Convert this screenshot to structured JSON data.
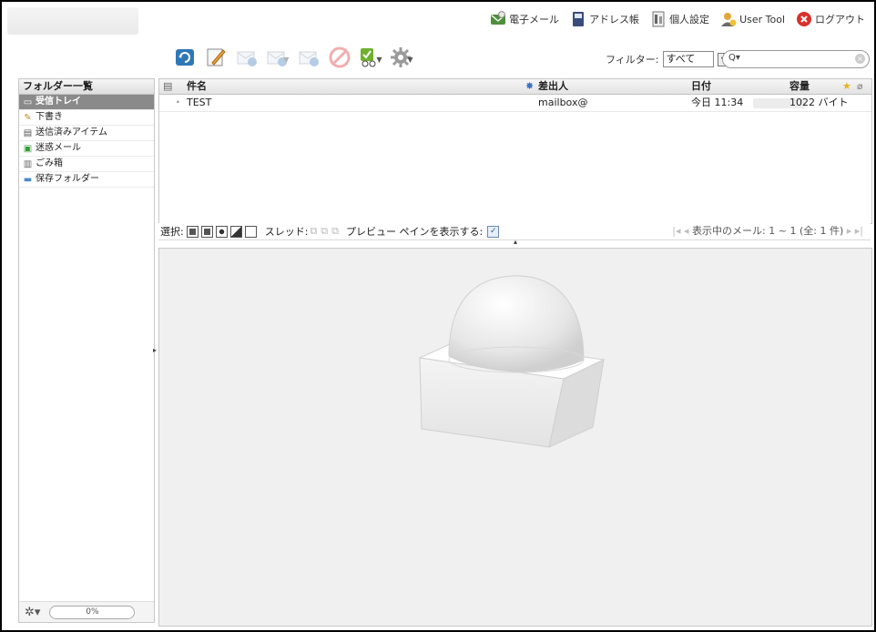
{
  "topnav": {
    "items": [
      {
        "label": "電子メール",
        "icon": "mail-icon"
      },
      {
        "label": "アドレス帳",
        "icon": "address-book-icon"
      },
      {
        "label": "個人設定",
        "icon": "settings-icon"
      },
      {
        "label": "User Tool",
        "icon": "user-icon"
      },
      {
        "label": "ログアウト",
        "icon": "logout-icon"
      }
    ]
  },
  "toolbar": {
    "buttons": [
      {
        "name": "check-mail",
        "icon": "refresh-icon"
      },
      {
        "name": "compose",
        "icon": "pencil-icon"
      },
      {
        "name": "reply",
        "icon": "reply-icon"
      },
      {
        "name": "reply-all",
        "icon": "reply-all-icon"
      },
      {
        "name": "forward",
        "icon": "forward-icon"
      },
      {
        "name": "delete",
        "icon": "delete-icon"
      },
      {
        "name": "mark",
        "icon": "mark-icon"
      },
      {
        "name": "more",
        "icon": "gear-icon"
      }
    ]
  },
  "filter": {
    "label": "フィルター:",
    "value": "すべて"
  },
  "search": {
    "placeholder": ""
  },
  "folders": {
    "header": "フォルダー一覧",
    "items": [
      {
        "label": "受信トレイ",
        "icon": "inbox-icon",
        "selected": true
      },
      {
        "label": "下書き",
        "icon": "drafts-icon",
        "selected": false
      },
      {
        "label": "送信済みアイテム",
        "icon": "sent-icon",
        "selected": false
      },
      {
        "label": "迷惑メール",
        "icon": "junk-icon",
        "selected": false
      },
      {
        "label": "ごみ箱",
        "icon": "trash-icon",
        "selected": false
      },
      {
        "label": "保存フォルダー",
        "icon": "folder-icon",
        "selected": false
      }
    ],
    "quota": "0%"
  },
  "messagelist": {
    "columns": {
      "subject": "件名",
      "from": "差出人",
      "date": "日付",
      "size": "容量"
    },
    "rows": [
      {
        "subject": "TEST",
        "from": "mailbox@",
        "date": "今日 11:34",
        "size": "1022 バイト"
      }
    ]
  },
  "listfooter": {
    "select_label": "選択:",
    "thread_label": "スレッド:",
    "preview_label": "プレビュー ペインを表示する:",
    "pager_text": "表示中のメール: 1 ~ 1 (全: 1 件)"
  },
  "colors": {
    "accent": "#6a8bb5",
    "selected_folder": "#8a8a8a"
  }
}
